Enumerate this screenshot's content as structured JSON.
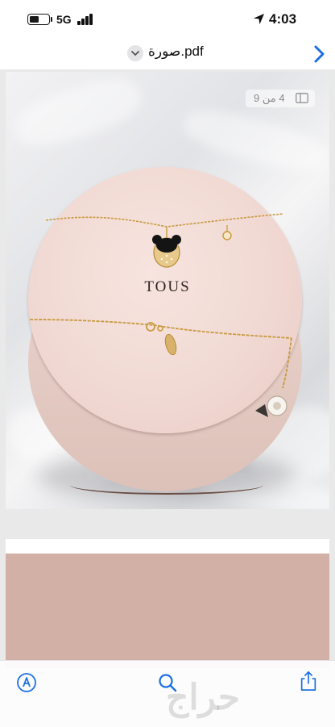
{
  "status_bar": {
    "network": "5G",
    "time": "4:03",
    "battery_level": 0.5,
    "signal_bars": 4
  },
  "title_bar": {
    "document_title": "صورة.pdf"
  },
  "viewer": {
    "page_indicator": "4 من 9",
    "brand_text": "TOUS"
  },
  "watermark": {
    "text": "حراج"
  },
  "icons": {
    "markup": "markup-pen-icon",
    "search": "search-icon",
    "share": "share-icon",
    "next": "chevron-right-icon",
    "dropdown": "chevron-down-icon",
    "location": "location-arrow-icon",
    "thumbnails": "thumbnail-view-icon"
  },
  "colors": {
    "accent": "#1a6fe3",
    "box_pink": "#f1d9d3",
    "gold": "#c89a3e"
  }
}
